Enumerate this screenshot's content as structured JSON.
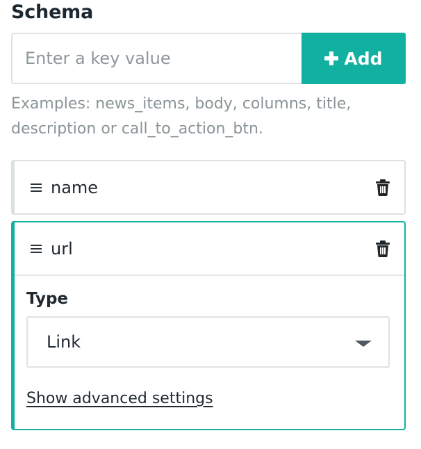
{
  "schema": {
    "title": "Schema",
    "key_input": {
      "value": "",
      "placeholder": "Enter a key value"
    },
    "add_button_label": "Add",
    "hint": "Examples: news_items, body, columns, title, description or call_to_action_btn.",
    "fields": [
      {
        "name": "name",
        "expanded": false
      },
      {
        "name": "url",
        "expanded": true,
        "type_label": "Type",
        "type_value": "Link",
        "advanced_link": "Show advanced settings"
      }
    ]
  },
  "icons": {
    "add": "plus-icon",
    "drag": "drag-handle-icon",
    "delete": "trash-icon",
    "dropdown": "caret-down-icon"
  },
  "colors": {
    "accent": "#12b0a0",
    "border": "#dbe0e3",
    "hint_text": "#8a9397"
  }
}
